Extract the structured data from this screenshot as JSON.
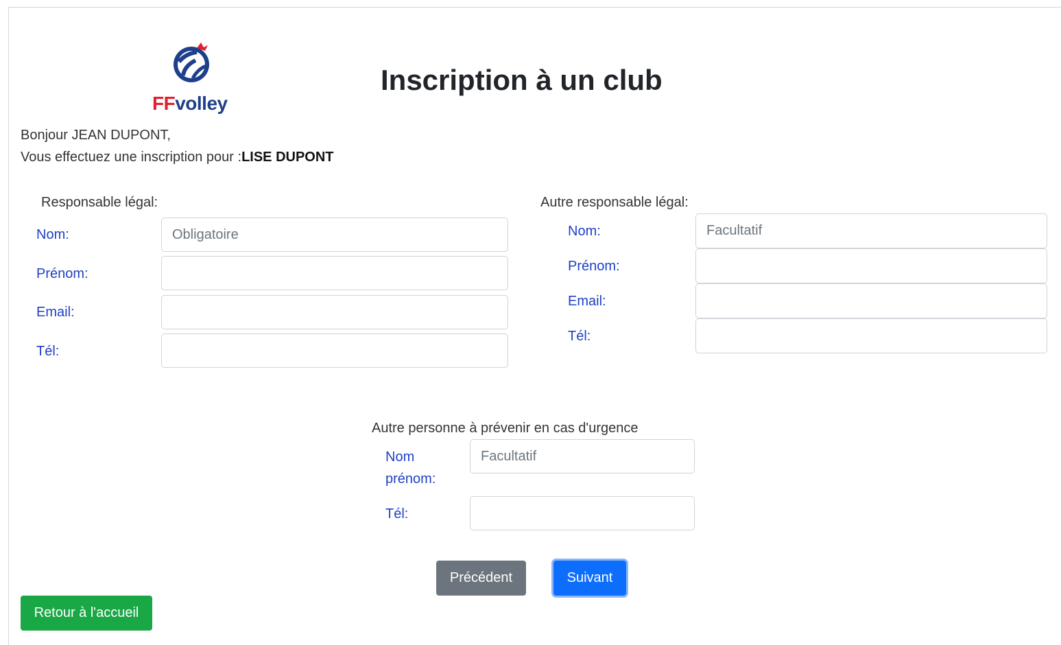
{
  "header": {
    "logo_ff": "FF",
    "logo_volley": "volley",
    "title": "Inscription à un club"
  },
  "greeting": {
    "line1": "Bonjour JEAN DUPONT,",
    "line2_prefix": "Vous effectuez une inscription pour :",
    "line2_name": "LISE DUPONT"
  },
  "legal_guardian": {
    "title": "Responsable légal:",
    "nom_label": "Nom:",
    "nom_placeholder": "Obligatoire",
    "prenom_label": "Prénom:",
    "email_label": "Email:",
    "tel_label": "Tél:"
  },
  "other_guardian": {
    "title": "Autre responsable légal:",
    "nom_label": "Nom:",
    "nom_placeholder": "Facultatif",
    "prenom_label": "Prénom:",
    "email_label": "Email:",
    "tel_label": "Tél:"
  },
  "emergency": {
    "title": "Autre personne à prévenir en cas d'urgence",
    "nom_label_line1": "Nom",
    "nom_label_line2": "prénom:",
    "nom_placeholder": "Facultatif",
    "tel_label": "Tél:"
  },
  "buttons": {
    "previous": "Précédent",
    "next": "Suivant",
    "home": "Retour à l'accueil"
  },
  "colors": {
    "label_blue": "#1f40c4",
    "btn_previous": "#6c757d",
    "btn_next": "#0d6efd",
    "btn_home": "#19a845",
    "brand_red": "#e0202d",
    "brand_blue": "#1e3f8a"
  }
}
